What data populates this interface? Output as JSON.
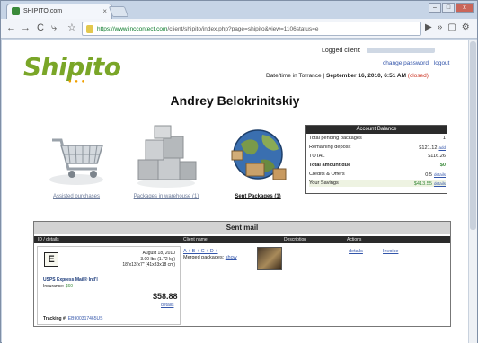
{
  "browser": {
    "tab_title": "SHIPITO.com",
    "url_host": "https://www.inccontect.com",
    "url_rest": "/client/shipito/index.php?page=shipito&view=1106status=e",
    "window_buttons": [
      "–",
      "□",
      "x"
    ]
  },
  "header": {
    "logo": "Shipito",
    "logged_label": "Logged client:",
    "links": [
      "change password",
      "logout"
    ],
    "datetime_label": "Date/time in Torrance",
    "datetime_value": "September 16, 2010, 6:51 AM",
    "status": "(closed)"
  },
  "client_name": "Andrey Belokrinitskiy",
  "tiles": [
    {
      "label": "Assisted purchases",
      "icon": "cart-icon"
    },
    {
      "label": "Packages in warehouse (1)",
      "icon": "boxes-icon"
    },
    {
      "label": "Sent Packages (1)",
      "icon": "globe-icon"
    }
  ],
  "balance": {
    "title": "Account Balance",
    "rows": [
      {
        "label": "Total pending packages",
        "value": "1",
        "detail": ""
      },
      {
        "label": "Remaining deposit",
        "value": "$121.12",
        "detail": "add"
      },
      {
        "label": "TOTAL",
        "value": "$116.26",
        "detail": ""
      },
      {
        "label": "Total amount due",
        "value": "$0",
        "detail": ""
      },
      {
        "label": "Credits & Offers",
        "value": "0.5",
        "detail": "details"
      },
      {
        "label": "Your Savings",
        "value": "$413.55",
        "detail": "details"
      }
    ]
  },
  "sent_mail": {
    "title": "Sent mail",
    "columns": [
      "ID / details",
      "Client name",
      "Description",
      "Actions"
    ],
    "card": {
      "letter": "E",
      "date": "August 18, 2010",
      "weight": "3.00 lbs (1.72 kg)",
      "dims": "18\"x13\"x7\" (41x33x18 cm)",
      "service": "USPS Express Mail® Intl'l",
      "insurance_label": "Insurance:",
      "insurance_value": "$60",
      "price": "$58.88",
      "price_details": "details",
      "tracking_label": "Tracking #:",
      "tracking_value": "EB900317465US"
    },
    "receiver": {
      "name_links": "A + B + C + D +",
      "merged_label": "Merged packages:",
      "merged_link": "show"
    },
    "actions": [
      "details",
      "Invoice"
    ]
  }
}
